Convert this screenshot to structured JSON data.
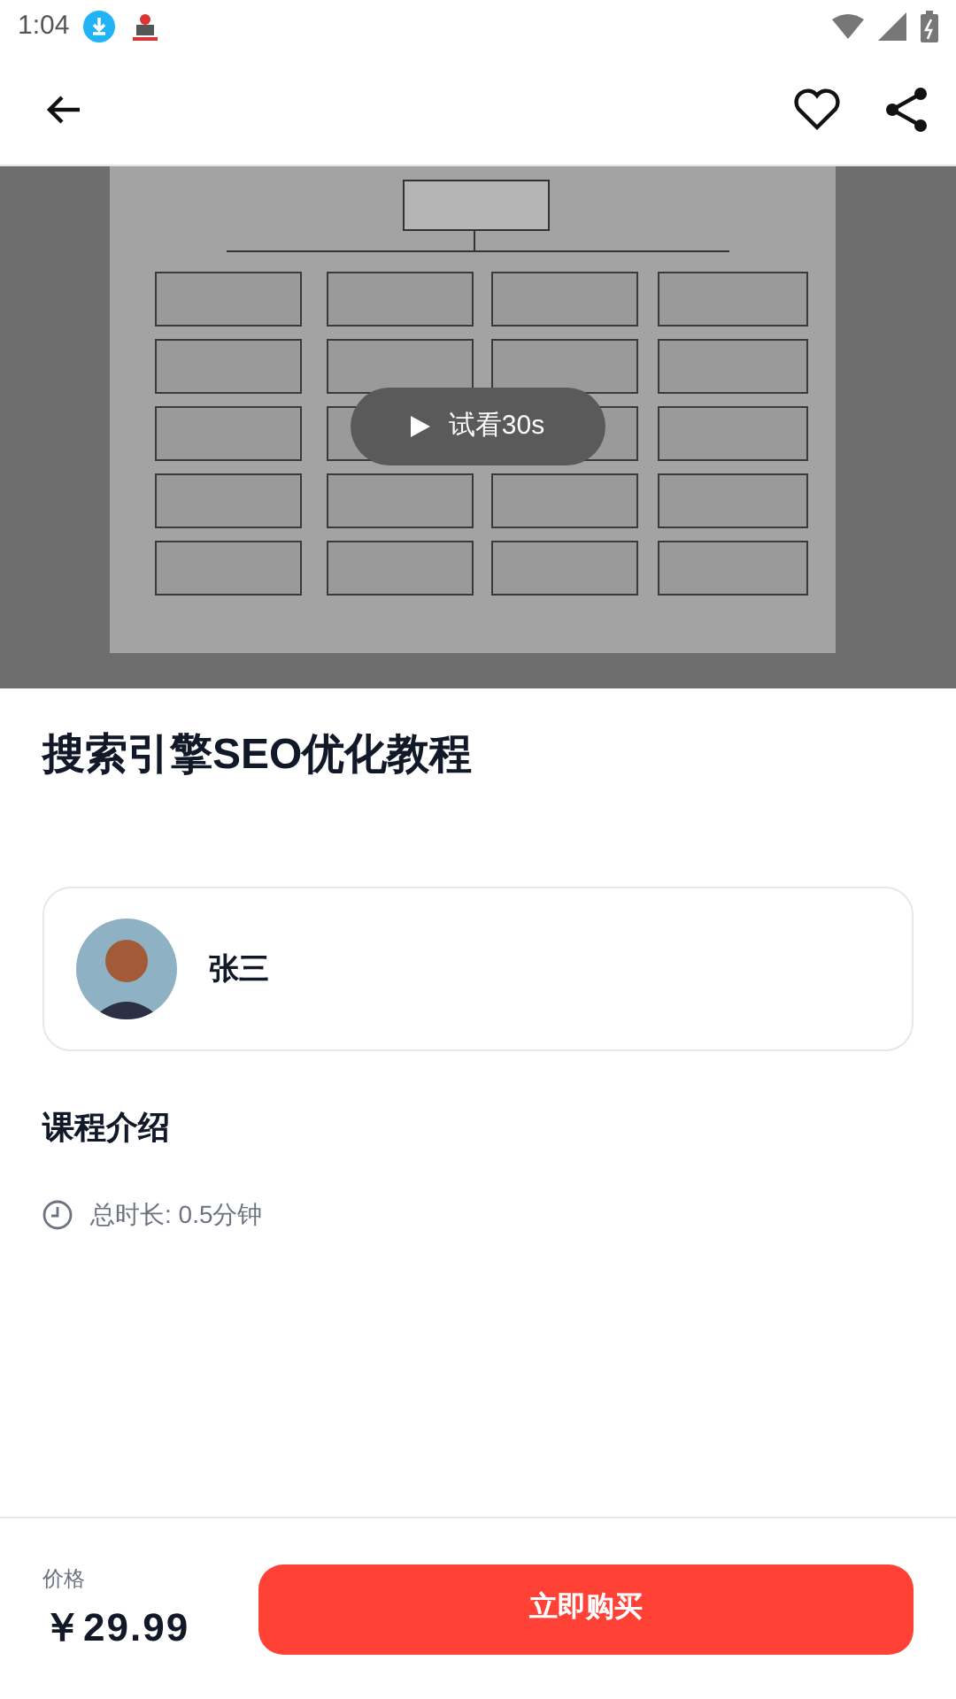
{
  "status_bar": {
    "time": "1:04"
  },
  "video": {
    "preview_label": "试看30s"
  },
  "course": {
    "title": "搜索引擎SEO优化教程"
  },
  "teacher": {
    "name": "张三"
  },
  "intro": {
    "heading": "课程介绍",
    "duration": "总时长: 0.5分钟"
  },
  "purchase": {
    "price_label": "价格",
    "price": "￥29.99",
    "buy_button": "立即购买"
  }
}
